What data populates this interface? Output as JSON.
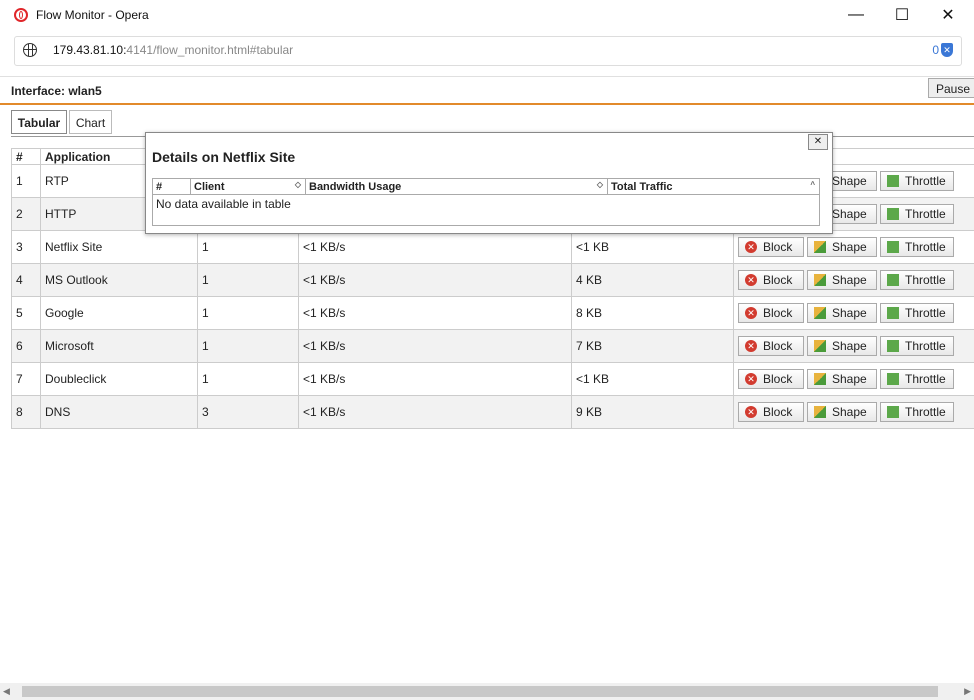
{
  "window": {
    "title": "Flow Monitor - Opera",
    "minimize": "—",
    "maximize": "☐",
    "close": "✕"
  },
  "address": {
    "host": "179.43.81.10:",
    "rest": "4141/flow_monitor.html#tabular",
    "adblock_count": "0"
  },
  "interface_label": "Interface: wlan5",
  "pause_label": "Pause",
  "tabs": [
    {
      "label": "Tabular"
    },
    {
      "label": "Chart"
    }
  ],
  "table": {
    "headers": [
      "#",
      "Application"
    ],
    "rows": [
      {
        "num": "1",
        "app": "RTP",
        "clients": "",
        "bandwidth": "",
        "traffic": ""
      },
      {
        "num": "2",
        "app": "HTTP",
        "clients": "",
        "bandwidth": "",
        "traffic": ""
      },
      {
        "num": "3",
        "app": "Netflix Site",
        "clients": "1",
        "bandwidth": "<1 KB/s",
        "traffic": "<1 KB"
      },
      {
        "num": "4",
        "app": "MS Outlook",
        "clients": "1",
        "bandwidth": "<1 KB/s",
        "traffic": "4 KB"
      },
      {
        "num": "5",
        "app": "Google",
        "clients": "1",
        "bandwidth": "<1 KB/s",
        "traffic": "8 KB"
      },
      {
        "num": "6",
        "app": "Microsoft",
        "clients": "1",
        "bandwidth": "<1 KB/s",
        "traffic": "7 KB"
      },
      {
        "num": "7",
        "app": "Doubleclick",
        "clients": "1",
        "bandwidth": "<1 KB/s",
        "traffic": "<1 KB"
      },
      {
        "num": "8",
        "app": "DNS",
        "clients": "3",
        "bandwidth": "<1 KB/s",
        "traffic": "9 KB"
      }
    ],
    "block_label": "Block",
    "shape_label": "Shape",
    "throttle_label": "Throttle"
  },
  "dialog": {
    "title": "Details on Netflix Site",
    "close": "✕",
    "headers": [
      "#",
      "Client",
      "Bandwidth Usage",
      "Total Traffic"
    ],
    "empty": "No data available in table"
  }
}
